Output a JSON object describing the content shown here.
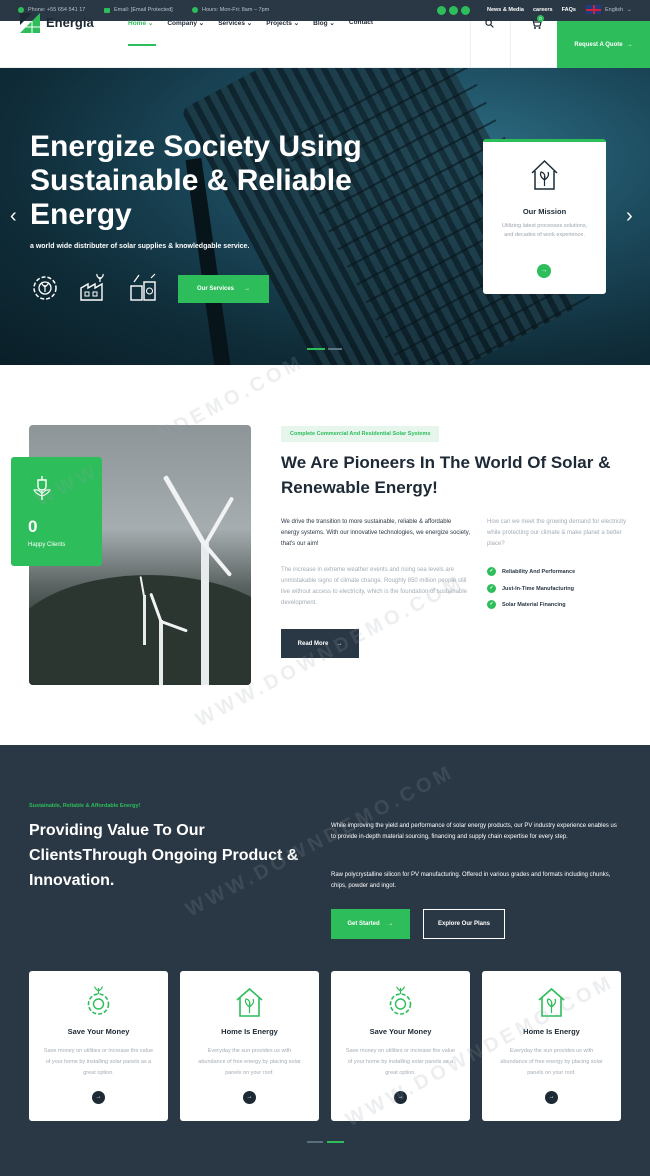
{
  "topbar": {
    "phone": "Phone: +55 654 541 17",
    "email": "Email: [Email Protected]",
    "hours": "Hours: Mon-Fri: 8am – 7pm",
    "links": [
      "News & Media",
      "careers",
      "FAQs"
    ],
    "language": "English"
  },
  "header": {
    "brand": "Energia",
    "nav": [
      "Home",
      "Company",
      "Services",
      "Projects",
      "Blog",
      "Contact"
    ],
    "cart_count": "0",
    "quote_label": "Request A Quote"
  },
  "hero": {
    "title": "Energize Society Using Sustainable & Reliable Energy",
    "subtitle": "a world wide distributer of solar supplies & knowledgable service.",
    "button": "Our Services",
    "mission": {
      "title": "Our Mission",
      "text": "Utilizing latest processes solutions, and decades of work experience."
    }
  },
  "about": {
    "tag": "Complete Commercial And Residential Solar Systems",
    "title": "We Are Pioneers In The World Of Solar & Renewable Energy!",
    "p1": "We drive the transition to more sustainable, reliable & affordable energy systems. With our innovative technologies, we energize society, that's our aim!",
    "p2": "The increase in extreme weather events and rising sea levels are unmistakable signs of climate change. Roughly 850 million people still live without access to electricity, which is the foundation of sustainable development.",
    "question": "How can we meet the growing demand for electricity while protecting our climate & make planet a better place?",
    "checks": [
      "Reliability And Performance",
      "Just-In-Time Manufacturing",
      "Solar Material Financing"
    ],
    "button": "Read More",
    "clients_count": "0",
    "clients_label": "Happy Clients"
  },
  "value": {
    "tag": "Sustainable, Reliable & Affordable Energy!",
    "title": "Providing Value To Our ClientsThrough Ongoing Product & Innovation.",
    "p1": "While improving the yield and performance of solar energy products, our PV industry experience enables us to provide in-depth material sourcing, financing and supply chain expertise for every step.",
    "p2": "Raw polycrystalline silicon for PV manufacturing. Offered in various grades and formats including chunks, chips, powder and ingot.",
    "btn_start": "Get Started",
    "btn_plans": "Explore Our Plans",
    "cards": [
      {
        "title": "Save Your Money",
        "text": "Save money on utilities or increase the value of your home by installing solar panels as a great option.",
        "icon": "gear-leaf-icon"
      },
      {
        "title": "Home Is Energy",
        "text": "Everyday the sun provides us with abundance of free energy by placing solar panels on your roof.",
        "icon": "eco-home-icon"
      },
      {
        "title": "Save Your Money",
        "text": "Save money on utilities or increase the value of your home by installing solar panels as a great option.",
        "icon": "gear-leaf-icon"
      },
      {
        "title": "Home Is Energy",
        "text": "Everyday the sun provides us with abundance of free energy by placing solar panels on your roof.",
        "icon": "eco-home-icon"
      }
    ]
  },
  "watermark": "WWW.DOWNDEMO.COM",
  "colors": {
    "accent": "#2dbd5a",
    "dark": "#2a3744"
  }
}
